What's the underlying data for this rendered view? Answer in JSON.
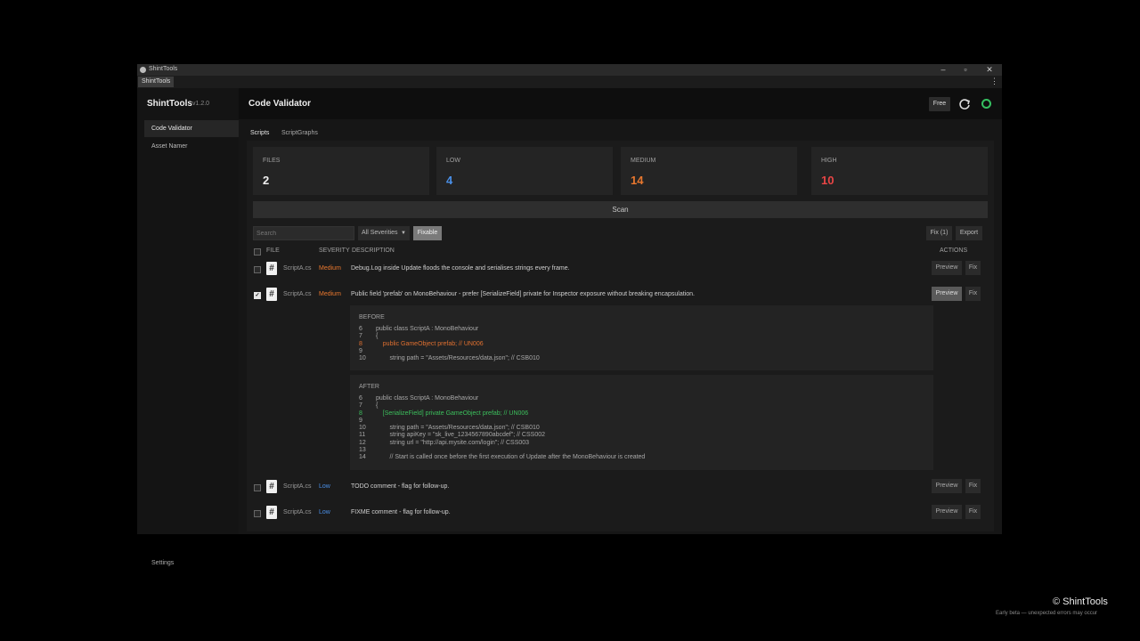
{
  "window": {
    "title": "ShintTools",
    "tab": "ShintTools",
    "controls": [
      "–",
      "▫",
      "✕"
    ]
  },
  "sidebar": {
    "brand": "ShintTools",
    "version": "v1.2.0",
    "items": [
      {
        "label": "Code Validator",
        "active": true
      },
      {
        "label": "Asset Namer",
        "active": false
      }
    ],
    "settings": "Settings"
  },
  "header": {
    "title": "Code Validator",
    "free_label": "Free",
    "status_color": "#35c060"
  },
  "tabs": [
    {
      "label": "Scripts",
      "active": true
    },
    {
      "label": "ScriptGraphs",
      "active": false
    }
  ],
  "stats": [
    {
      "label": "FILES",
      "value": "2",
      "color": "#f0f0f0"
    },
    {
      "label": "LOW",
      "value": "4",
      "color": "#4a8fe7"
    },
    {
      "label": "MEDIUM",
      "value": "14",
      "color": "#e8772e"
    },
    {
      "label": "HIGH",
      "value": "10",
      "color": "#e84545"
    }
  ],
  "scan_label": "Scan",
  "toolbar": {
    "search_placeholder": "Search",
    "severity_select": "All Severities",
    "fixable_label": "Fixable",
    "fix_label": "Fix (1)",
    "export_label": "Export"
  },
  "columns": {
    "file": "FILE",
    "severity": "SEVERITY",
    "description": "DESCRIPTION",
    "actions": "ACTIONS"
  },
  "actions": {
    "preview": "Preview",
    "fix": "Fix"
  },
  "rows": [
    {
      "file": "ScriptA.cs",
      "severity": "Medium",
      "description": "Debug.Log inside Update floods the console and serialises strings every frame.",
      "checked": false
    },
    {
      "file": "ScriptA.cs",
      "severity": "Medium",
      "description": "Public field 'prefab' on MonoBehaviour - prefer [SerializeField] private for Inspector exposure without breaking encapsulation.",
      "checked": true
    },
    {
      "file": "ScriptA.cs",
      "severity": "Low",
      "description": "TODO comment - flag for follow-up.",
      "checked": false
    },
    {
      "file": "ScriptA.cs",
      "severity": "Low",
      "description": "FIXME comment - flag for follow-up.",
      "checked": false
    }
  ],
  "severity_colors": {
    "Medium": "#e8772e",
    "Low": "#4a8fe7"
  },
  "preview": {
    "before_label": "BEFORE",
    "before": [
      {
        "n": "6",
        "text": "public class ScriptA : MonoBehaviour"
      },
      {
        "n": "7",
        "text": "{"
      },
      {
        "n": "8",
        "text": "    public GameObject prefab; // UN006"
      },
      {
        "n": "9",
        "text": ""
      },
      {
        "n": "10",
        "text": "        string path = \"Assets/Resources/data.json\"; // CSB010"
      }
    ],
    "after_label": "AFTER",
    "after": [
      {
        "n": "6",
        "text": "public class ScriptA : MonoBehaviour"
      },
      {
        "n": "7",
        "text": "{"
      },
      {
        "n": "8",
        "text": "    [SerializeField] private GameObject prefab; // UN006"
      },
      {
        "n": "9",
        "text": ""
      },
      {
        "n": "10",
        "text": "        string path = \"Assets/Resources/data.json\"; // CSB010"
      },
      {
        "n": "11",
        "text": "        string apiKey = \"sk_live_1234567890abcdef\"; // CSS002"
      },
      {
        "n": "12",
        "text": "        string url = \"http://api.mysite.com/login\"; // CSS003"
      },
      {
        "n": "13",
        "text": ""
      },
      {
        "n": "14",
        "text": "        // Start is called once before the first execution of Update after the MonoBehaviour is created"
      }
    ]
  },
  "footer": {
    "brand": "© ShintTools",
    "note": "Early beta — unexpected errors may occur"
  }
}
